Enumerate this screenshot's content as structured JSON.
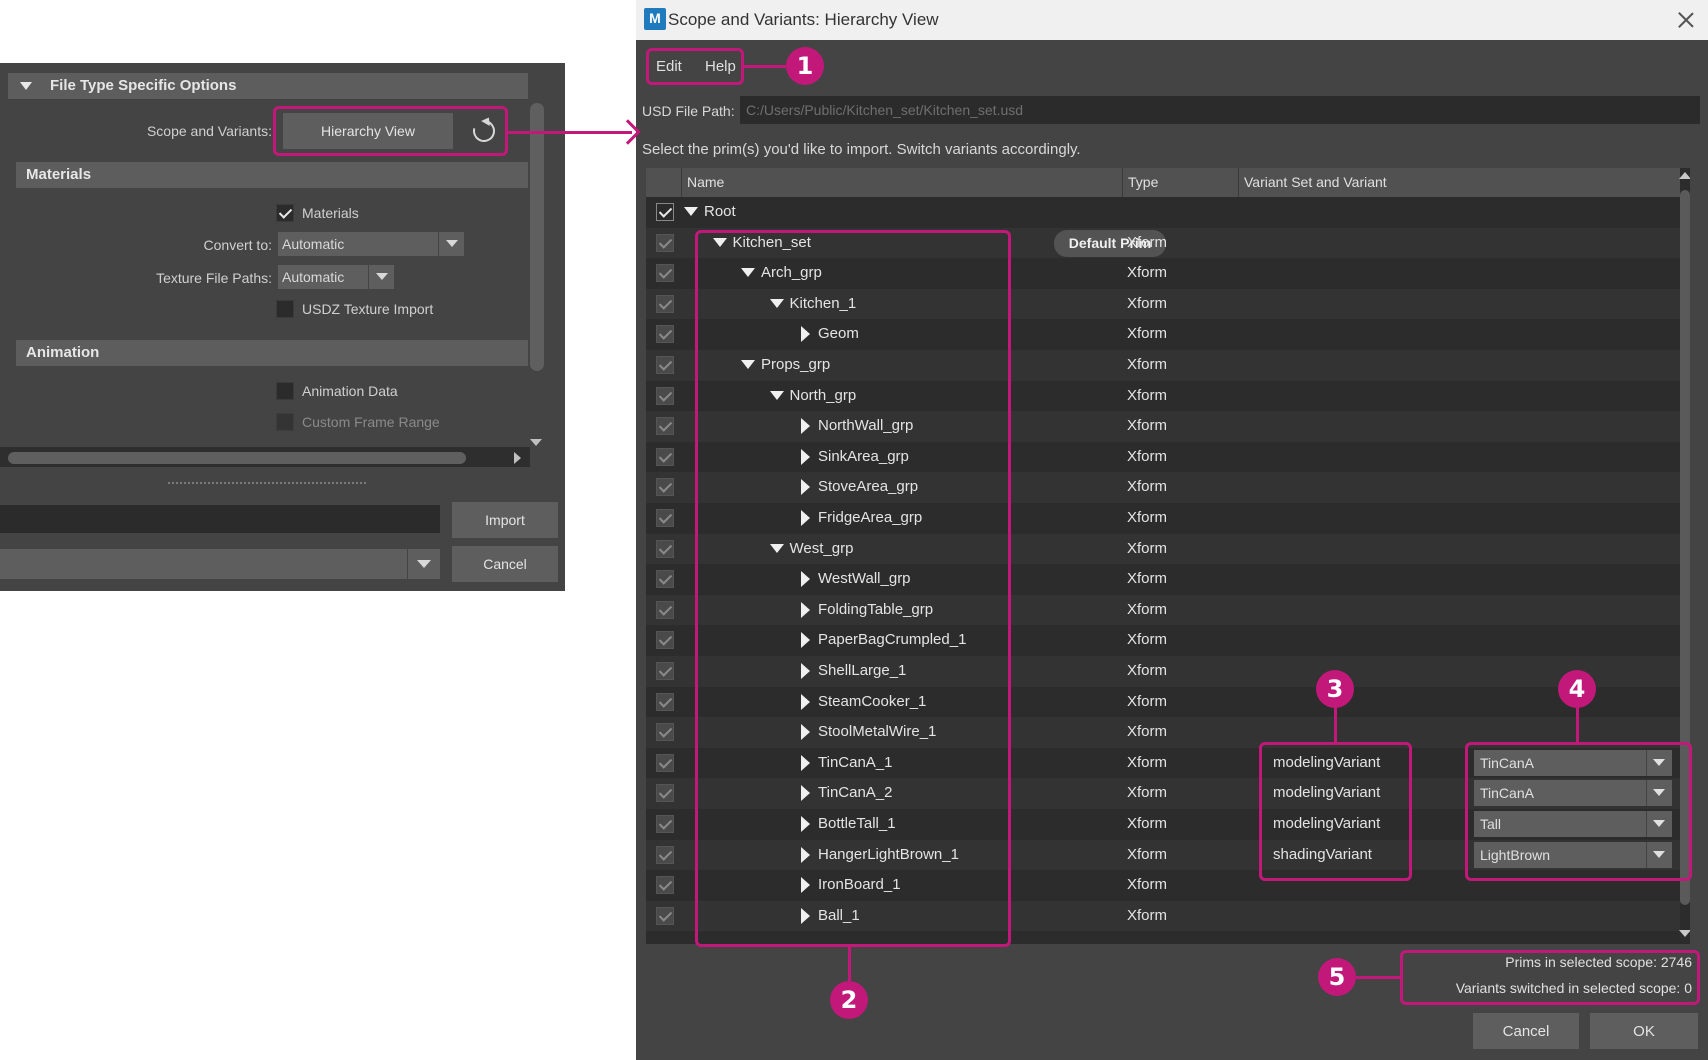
{
  "left_panel": {
    "file_type_options_header": "File Type Specific Options",
    "scope_label": "Scope and Variants:",
    "hierarchy_view_button": "Hierarchy View",
    "materials_header": "Materials",
    "materials_checkbox_label": "Materials",
    "materials_checked": true,
    "convert_to_label": "Convert to:",
    "convert_to_value": "Automatic",
    "texture_paths_label": "Texture File Paths:",
    "texture_paths_value": "Automatic",
    "usdz_texture_label": "USDZ Texture Import",
    "animation_header": "Animation",
    "animation_data_label": "Animation Data",
    "custom_frame_range_label": "Custom Frame Range",
    "import_button": "Import",
    "cancel_button": "Cancel"
  },
  "dialog": {
    "title": "Scope and Variants: Hierarchy View",
    "app_icon_letter": "M",
    "menu": [
      "Edit",
      "Help"
    ],
    "usd_path_label": "USD File Path:",
    "usd_path_value": "C:/Users/Public/Kitchen_set/Kitchen_set.usd",
    "instructions": "Select the prim(s) you'd like to import. Switch variants accordingly.",
    "columns": {
      "name": "Name",
      "type": "Type",
      "variant": "Variant Set and Variant"
    },
    "default_prim_label": "Default Prim",
    "rows": [
      {
        "name": "Root",
        "type": "",
        "depth": 0,
        "expanded": true,
        "root": true
      },
      {
        "name": "Kitchen_set",
        "type": "Xform",
        "depth": 1,
        "expanded": true,
        "default_prim": true
      },
      {
        "name": "Arch_grp",
        "type": "Xform",
        "depth": 2,
        "expanded": true
      },
      {
        "name": "Kitchen_1",
        "type": "Xform",
        "depth": 3,
        "expanded": true
      },
      {
        "name": "Geom",
        "type": "Xform",
        "depth": 4,
        "expanded": false
      },
      {
        "name": "Props_grp",
        "type": "Xform",
        "depth": 2,
        "expanded": true
      },
      {
        "name": "North_grp",
        "type": "Xform",
        "depth": 3,
        "expanded": true
      },
      {
        "name": "NorthWall_grp",
        "type": "Xform",
        "depth": 4,
        "expanded": false
      },
      {
        "name": "SinkArea_grp",
        "type": "Xform",
        "depth": 4,
        "expanded": false
      },
      {
        "name": "StoveArea_grp",
        "type": "Xform",
        "depth": 4,
        "expanded": false
      },
      {
        "name": "FridgeArea_grp",
        "type": "Xform",
        "depth": 4,
        "expanded": false
      },
      {
        "name": "West_grp",
        "type": "Xform",
        "depth": 3,
        "expanded": true
      },
      {
        "name": "WestWall_grp",
        "type": "Xform",
        "depth": 4,
        "expanded": false
      },
      {
        "name": "FoldingTable_grp",
        "type": "Xform",
        "depth": 4,
        "expanded": false
      },
      {
        "name": "PaperBagCrumpled_1",
        "type": "Xform",
        "depth": 4,
        "expanded": false
      },
      {
        "name": "ShellLarge_1",
        "type": "Xform",
        "depth": 4,
        "expanded": false
      },
      {
        "name": "SteamCooker_1",
        "type": "Xform",
        "depth": 4,
        "expanded": false
      },
      {
        "name": "StoolMetalWire_1",
        "type": "Xform",
        "depth": 4,
        "expanded": false
      },
      {
        "name": "TinCanA_1",
        "type": "Xform",
        "depth": 4,
        "expanded": false,
        "variant_set": "modelingVariant",
        "variant": "TinCanA"
      },
      {
        "name": "TinCanA_2",
        "type": "Xform",
        "depth": 4,
        "expanded": false,
        "variant_set": "modelingVariant",
        "variant": "TinCanA"
      },
      {
        "name": "BottleTall_1",
        "type": "Xform",
        "depth": 4,
        "expanded": false,
        "variant_set": "modelingVariant",
        "variant": "Tall"
      },
      {
        "name": "HangerLightBrown_1",
        "type": "Xform",
        "depth": 4,
        "expanded": false,
        "variant_set": "shadingVariant",
        "variant": "LightBrown"
      },
      {
        "name": "IronBoard_1",
        "type": "Xform",
        "depth": 4,
        "expanded": false
      },
      {
        "name": "Ball_1",
        "type": "Xform",
        "depth": 4,
        "expanded": false
      }
    ],
    "prims_in_scope": "Prims in selected scope: 2746",
    "variants_switched": "Variants switched in selected scope: 0",
    "cancel_button": "Cancel",
    "ok_button": "OK"
  },
  "callouts": [
    "1",
    "2",
    "3",
    "4",
    "5"
  ],
  "colors": {
    "accent": "#c2187a",
    "panel_bg": "#444444",
    "tree_bg": "#2c2c2c"
  }
}
